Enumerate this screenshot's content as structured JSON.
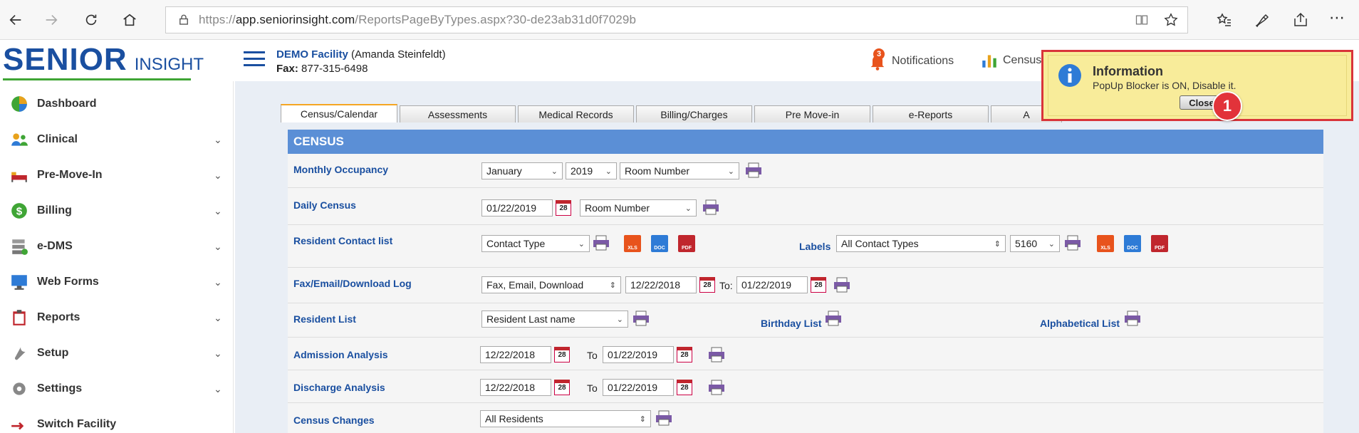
{
  "browser": {
    "url_prefix": "https://",
    "url_host": "app.seniorinsight.com",
    "url_path": "/ReportsPageByTypes.aspx?30-de23ab31d0f7029b"
  },
  "header": {
    "logo_main": "SENIOR",
    "logo_sub": "INSIGHT",
    "facility_name": "DEMO Facility",
    "facility_user": "(Amanda Steinfeldt)",
    "fax_label": "Fax:",
    "fax_number": "877-315-6498",
    "notifications_label": "Notifications",
    "notifications_count": "3",
    "census_label": "Census"
  },
  "sidebar": {
    "items": [
      {
        "label": "Dashboard",
        "icon": "dashboard-icon",
        "has_children": false
      },
      {
        "label": "Clinical",
        "icon": "clinical-icon",
        "has_children": true
      },
      {
        "label": "Pre-Move-In",
        "icon": "bed-icon",
        "has_children": true
      },
      {
        "label": "Billing",
        "icon": "dollar-icon",
        "has_children": true
      },
      {
        "label": "e-DMS",
        "icon": "database-icon",
        "has_children": true
      },
      {
        "label": "Web Forms",
        "icon": "monitor-icon",
        "has_children": true
      },
      {
        "label": "Reports",
        "icon": "clipboard-icon",
        "has_children": true
      },
      {
        "label": "Setup",
        "icon": "wrench-icon",
        "has_children": true
      },
      {
        "label": "Settings",
        "icon": "gear-icon",
        "has_children": true
      },
      {
        "label": "Switch Facility",
        "icon": "switch-icon",
        "has_children": false
      }
    ]
  },
  "tabs": [
    "Census/Calendar",
    "Assessments",
    "Medical Records",
    "Billing/Charges",
    "Pre Move-in",
    "e-Reports",
    "A"
  ],
  "census": {
    "heading": "CENSUS",
    "monthly_occupancy": {
      "label": "Monthly Occupancy",
      "month": "January",
      "year": "2019",
      "sort": "Room Number"
    },
    "daily_census": {
      "label": "Daily Census",
      "date": "01/22/2019",
      "sort": "Room Number"
    },
    "contact_list": {
      "label": "Resident Contact list",
      "type": "Contact Type",
      "labels_label": "Labels",
      "labels_value": "All Contact Types",
      "labels_size": "5160"
    },
    "fax_log": {
      "label": "Fax/Email/Download Log",
      "type": "Fax, Email, Download",
      "from": "12/22/2018",
      "to_label": "To:",
      "to": "01/22/2019"
    },
    "resident_list": {
      "label": "Resident List",
      "sort": "Resident Last name",
      "birthday": "Birthday List",
      "alpha": "Alphabetical List"
    },
    "admission": {
      "label": "Admission Analysis",
      "from": "12/22/2018",
      "to_label": "To",
      "to": "01/22/2019"
    },
    "discharge": {
      "label": "Discharge Analysis",
      "from": "12/22/2018",
      "to_label": "To",
      "to": "01/22/2019"
    },
    "changes": {
      "label": "Census Changes",
      "value": "All Residents"
    },
    "calendar_day": "28",
    "doc_types": [
      "XLS",
      "DOC",
      "PDF"
    ]
  },
  "popup": {
    "title": "Information",
    "message": "PopUp Blocker is ON, Disable it.",
    "close_label": "Close",
    "step_number": "1"
  },
  "colors": {
    "brand_blue": "#1a4fa0",
    "census_header": "#5b8fd6",
    "popup_bg": "#f8ec9a",
    "highlight_red": "#d9343a"
  }
}
